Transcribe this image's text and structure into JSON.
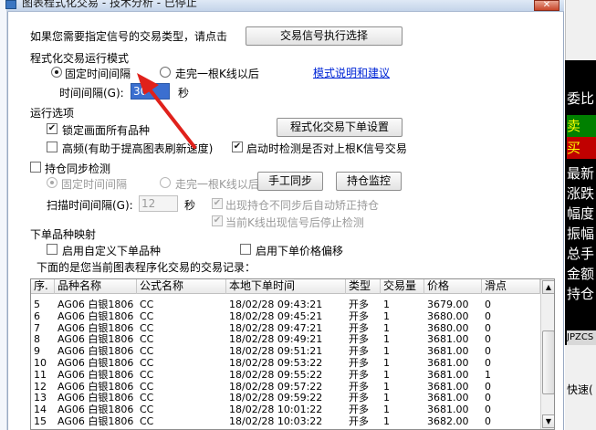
{
  "window": {
    "title": "图表程式化交易 - 技术分析 - 已停止",
    "close_glyph": "✕"
  },
  "signal_type": {
    "prompt": "如果您需要指定信号的交易类型，请点击",
    "button": "交易信号执行选择"
  },
  "mode": {
    "group_title": "程式化交易运行模式",
    "fixed_interval_label": "固定时间间隔",
    "after_kline_label": "走完一根K线以后",
    "selected": "fixed_interval",
    "help_link": "模式说明和建议",
    "interval_label": "时间间隔(G):",
    "interval_value": "30",
    "interval_unit": "秒"
  },
  "options": {
    "group_title": "运行选项",
    "lock_chart_label": "锁定画面所有品种",
    "lock_chart_checked": true,
    "order_settings_button": "程式化交易下单设置",
    "high_freq_label": "高频(有助于提高图表刷新速度)",
    "high_freq_checked": false,
    "check_on_start_label": "启动时检测是否对上根K信号交易",
    "check_on_start_checked": true
  },
  "position_sync": {
    "label": "持仓同步检测",
    "checked": false,
    "fixed_interval_label": "固定时间间隔",
    "after_kline_label": "走完一根K线以后",
    "manual_sync_button": "手工同步",
    "position_monitor_button": "持仓监控",
    "scan_label": "扫描时间间隔(G):",
    "scan_value": "12",
    "scan_unit": "秒",
    "auto_fix_label": "出现持仓不同步后自动矫正持仓",
    "auto_fix_checked": true,
    "stop_on_kline_label": "当前K线出现信号后停止检测",
    "stop_on_kline_checked": true
  },
  "order_mapping": {
    "group_title": "下单品种映射",
    "custom_symbol_label": "启用自定义下单品种",
    "custom_symbol_checked": false,
    "price_offset_label": "启用下单价格偏移",
    "price_offset_checked": false
  },
  "records": {
    "caption": "下面的是您当前图表程序化交易的交易记录：",
    "columns": [
      "序.",
      "品种名称",
      "公式名称",
      "本地下单时间",
      "类型",
      "交易量",
      "价格",
      "滑点"
    ],
    "rows": [
      [
        "5",
        "AG06 白银1806",
        "CC",
        "18/02/28 09:43:21",
        "开多",
        "1",
        "3679.00",
        "0"
      ],
      [
        "6",
        "AG06 白银1806",
        "CC",
        "18/02/28 09:45:21",
        "开多",
        "1",
        "3680.00",
        "0"
      ],
      [
        "7",
        "AG06 白银1806",
        "CC",
        "18/02/28 09:47:21",
        "开多",
        "1",
        "3680.00",
        "0"
      ],
      [
        "8",
        "AG06 白银1806",
        "CC",
        "18/02/28 09:49:21",
        "开多",
        "1",
        "3681.00",
        "0"
      ],
      [
        "9",
        "AG06 白银1806",
        "CC",
        "18/02/28 09:51:21",
        "开多",
        "1",
        "3681.00",
        "0"
      ],
      [
        "10",
        "AG06 白银1806",
        "CC",
        "18/02/28 09:53:22",
        "开多",
        "1",
        "3681.00",
        "0"
      ],
      [
        "11",
        "AG06 白银1806",
        "CC",
        "18/02/28 09:55:22",
        "开多",
        "1",
        "3681.00",
        "1"
      ],
      [
        "12",
        "AG06 白银1806",
        "CC",
        "18/02/28 09:57:22",
        "开多",
        "1",
        "3681.00",
        "0"
      ],
      [
        "13",
        "AG06 白银1806",
        "CC",
        "18/02/28 09:59:22",
        "开多",
        "1",
        "3681.00",
        "0"
      ],
      [
        "14",
        "AG06 白银1806",
        "CC",
        "18/02/28 10:01:22",
        "开多",
        "1",
        "3681.00",
        "0"
      ],
      [
        "15",
        "AG06 白银1806",
        "CC",
        "18/02/28 10:03:22",
        "开多",
        "1",
        "3682.00",
        "0"
      ]
    ]
  },
  "right_panel": {
    "cells": [
      "委比",
      "卖",
      "买",
      "最新",
      "涨跌",
      "幅度",
      "振幅",
      "总手",
      "金额",
      "持仓"
    ],
    "cell_colors": [
      "#ffffff",
      "#ffff00",
      "#ffff00",
      "#ffffff",
      "#ffffff",
      "#ffffff",
      "#ffffff",
      "#ffffff",
      "#ffffff",
      "#ffffff"
    ],
    "jpzcs": "JPZCS",
    "speed": "快速("
  },
  "colors": {
    "sell_bg": "#008000",
    "buy_bg": "#c00000",
    "arrow": "#e0211b",
    "link": "#0026d6"
  }
}
